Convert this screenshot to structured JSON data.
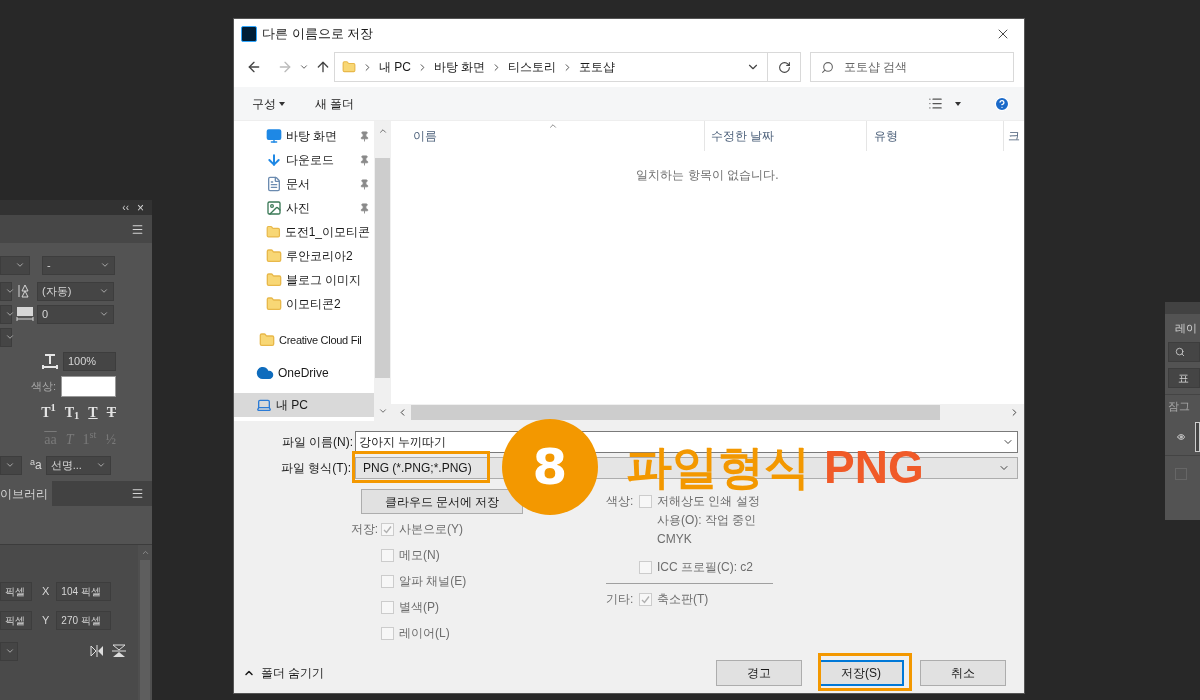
{
  "left_panel": {
    "collapse": "‹‹",
    "close": "×",
    "font_style": "-",
    "leading": "(자동)",
    "tracking": "0",
    "horizontal_scale": "100%",
    "color_label": "색상:",
    "type_styles": [
      {
        "label": "T$^{1}$",
        "kind": "plain"
      },
      {
        "label": "T$_{1}$",
        "kind": "plain"
      },
      {
        "label": "T",
        "kind": "underline"
      },
      {
        "label": "T",
        "kind": "strike"
      }
    ],
    "opentype": [
      {
        "label": "aa",
        "kind": "overline"
      },
      {
        "label": "T",
        "kind": "italic"
      },
      {
        "label": "1$^{st}$",
        "kind": "plain"
      },
      {
        "label": "½",
        "kind": "plain"
      }
    ],
    "opentype_disabled": true,
    "antialias_label": "$^{a}$a",
    "antialias": "선명...",
    "tab": "이브러리",
    "width_unit": "픽셀",
    "x_label": "X",
    "x_value": "104 픽셀",
    "height_unit": "픽셀",
    "y_label": "Y",
    "y_value": "270 픽셀"
  },
  "right_panel": {
    "title": "레이",
    "blend_mode": "표",
    "lock_label": "잠그",
    "layer_checked": false
  },
  "dialog": {
    "title": "다른 이름으로 저장",
    "breadcrumb": [
      "내 PC",
      "바탕 화면",
      "티스토리",
      "포토샵"
    ],
    "search_placeholder": "포토샵 검색",
    "organize": "구성",
    "new_folder": "새 폴더",
    "nav_items": [
      {
        "label": "바탕 화면",
        "kind": "desktop",
        "pinned": true,
        "selected": false
      },
      {
        "label": "다운로드",
        "kind": "download",
        "pinned": true,
        "selected": false
      },
      {
        "label": "문서",
        "kind": "document",
        "pinned": true,
        "selected": false
      },
      {
        "label": "사진",
        "kind": "pictures",
        "pinned": true,
        "selected": false
      },
      {
        "label": "도전1_이모티콘",
        "kind": "folder",
        "pinned": false,
        "selected": false
      },
      {
        "label": "루안코리아2",
        "kind": "folder",
        "pinned": false,
        "selected": false
      },
      {
        "label": "블로그 이미지",
        "kind": "folder",
        "pinned": false,
        "selected": false
      },
      {
        "label": "이모티콘2",
        "kind": "folder",
        "pinned": false,
        "selected": false
      },
      {
        "label": "Creative Cloud Fil",
        "kind": "cloud-files",
        "pinned": false,
        "selected": false
      },
      {
        "label": "OneDrive",
        "kind": "onedrive",
        "pinned": false,
        "selected": false
      },
      {
        "label": "내 PC",
        "kind": "pc",
        "pinned": false,
        "selected": true
      }
    ],
    "columns": [
      "이름",
      "수정한 날짜",
      "유형",
      "크"
    ],
    "empty_message": "일치하는 항목이 없습니다.",
    "file_name_label": "파일 이름(N):",
    "file_name": "강아지 누끼따기",
    "file_type_label": "파일 형식(T):",
    "file_type": "PNG (*.PNG;*.PNG)",
    "file_type_highlighted": true,
    "cloud_button": "클라우드 문서에 저장",
    "save_label": "저장:",
    "save_options": [
      {
        "label": "사본으로(Y)",
        "checked": true,
        "disabled": true
      },
      {
        "label": "메모(N)",
        "checked": false,
        "disabled": true
      },
      {
        "label": "알파 채널(E)",
        "checked": false,
        "disabled": true
      },
      {
        "label": "별색(P)",
        "checked": false,
        "disabled": true
      },
      {
        "label": "레이어(L)",
        "checked": false,
        "disabled": true
      }
    ],
    "color_label": "색상:",
    "color_options": [
      {
        "label": "저해상도 인쇄 설정 사용(O): 작업 중인 CMYK",
        "checked": false,
        "disabled": true
      },
      {
        "label": "ICC 프로필(C): c2",
        "checked": false,
        "disabled": true
      }
    ],
    "other_label": "기타:",
    "other_options": [
      {
        "label": "축소판(T)",
        "checked": true,
        "disabled": true
      }
    ],
    "hide_folders": "폴더 숨기기",
    "buttons": [
      {
        "label": "경고",
        "default": false,
        "highlighted": false
      },
      {
        "label": "저장(S)",
        "default": true,
        "highlighted": true
      },
      {
        "label": "취소",
        "default": false,
        "highlighted": false
      }
    ]
  },
  "annotation": {
    "step": "8",
    "caption": [
      {
        "text": "파일형식",
        "color": "#f39800"
      },
      {
        "text": "PNG",
        "color": "#f05a28"
      }
    ]
  }
}
